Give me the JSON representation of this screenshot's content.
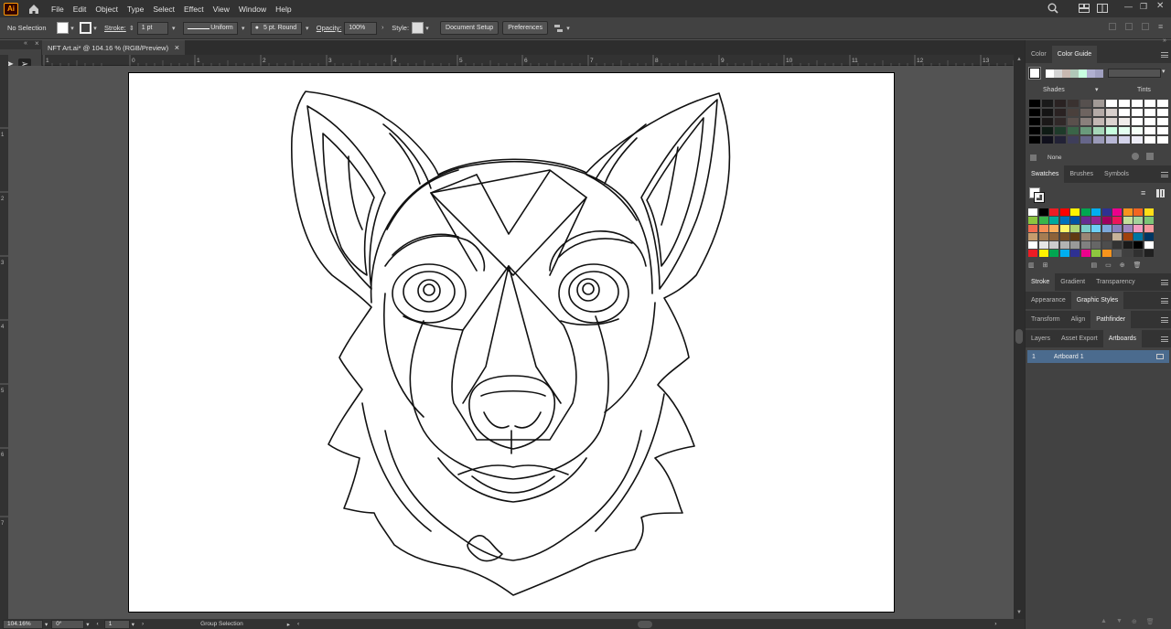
{
  "app": {
    "logo": "Ai",
    "home_icon": "home-icon"
  },
  "menu": [
    "File",
    "Edit",
    "Object",
    "Type",
    "Select",
    "Effect",
    "View",
    "Window",
    "Help"
  ],
  "control_bar": {
    "selection": "No Selection",
    "stroke_label": "Stroke:",
    "stroke_weight": "1 pt",
    "profile": "Uniform",
    "brush": "5 pt. Round",
    "opacity_label": "Opacity:",
    "opacity": "100%",
    "style_label": "Style:",
    "document_setup": "Document Setup",
    "preferences": "Preferences"
  },
  "document": {
    "tab_title": "NFT Art.ai* @ 104.16 % (RGB/Preview)",
    "close": "×"
  },
  "ruler": {
    "h_ticks": [
      "1",
      "0",
      "1",
      "2",
      "3",
      "4",
      "5",
      "6",
      "7",
      "8",
      "9",
      "10",
      "11",
      "12",
      "13"
    ],
    "v_ticks": [
      "1",
      "2",
      "3",
      "4",
      "5",
      "6",
      "7"
    ]
  },
  "status": {
    "zoom": "104.16%",
    "rotate": "0°",
    "artboard": "1",
    "tool": "Group Selection"
  },
  "panels": {
    "color_tabs": [
      "Color",
      "Color Guide"
    ],
    "shades_label": "Shades",
    "tints_label": "Tints",
    "none_label": "None",
    "swatch_tabs": [
      "Swatches",
      "Brushes",
      "Symbols"
    ],
    "stroke_tabs": [
      "Stroke",
      "Gradient",
      "Transparency"
    ],
    "appearance_tabs": [
      "Appearance",
      "Graphic Styles"
    ],
    "transform_tabs": [
      "Transform",
      "Align",
      "Pathfinder"
    ],
    "layers_tabs": [
      "Layers",
      "Asset Export",
      "Artboards"
    ],
    "artboard_row": {
      "index": "1",
      "name": "Artboard 1"
    }
  },
  "colors": {
    "harmony": [
      "#ffffff",
      "#d4d4d4",
      "#c8b8b0",
      "#b0c8b8",
      "#c8ffe0",
      "#b0b0d0",
      "#a0a0c0"
    ],
    "shades": [
      [
        "#000000",
        "#1a1a1a",
        "#2a2222",
        "#3a3230",
        "#56504e",
        "#a29a96",
        "#ffffff",
        "#ffffff",
        "#ffffff",
        "#ffffff",
        "#ffffff"
      ],
      [
        "#000000",
        "#141414",
        "#2a2222",
        "#4a403c",
        "#6e6460",
        "#b4aaa6",
        "#d8d0cc",
        "#ffffff",
        "#ffffff",
        "#ffffff",
        "#ffffff"
      ],
      [
        "#000000",
        "#1a1818",
        "#302828",
        "#5a504c",
        "#8a807c",
        "#c4b8b4",
        "#dcd4d0",
        "#f0ecea",
        "#ffffff",
        "#ffffff",
        "#ffffff"
      ],
      [
        "#000000",
        "#0e1a14",
        "#1e3a2a",
        "#3a6448",
        "#6a9a7c",
        "#a6d6b8",
        "#c8ffe0",
        "#e4fff0",
        "#f4fff8",
        "#ffffff",
        "#ffffff"
      ],
      [
        "#000000",
        "#10101c",
        "#222236",
        "#3e3e5a",
        "#66668a",
        "#9a9ab8",
        "#b8b8d6",
        "#d4d4ea",
        "#ececf6",
        "#ffffff",
        "#ffffff"
      ]
    ],
    "swatches": [
      [
        "#ffffff",
        "#000000",
        "#ed1c24",
        "#ff0000",
        "#fff200",
        "#00a651",
        "#00aeef",
        "#2e3192",
        "#ec008c",
        "#f7941d",
        "#f26522",
        "#ffde17"
      ],
      [
        "#8dc63f",
        "#39b54a",
        "#00a99d",
        "#0072bc",
        "#0054a6",
        "#662d91",
        "#92278f",
        "#9e005d",
        "#ed145b",
        "#c4df9b",
        "#a3d39c",
        "#7cc576"
      ],
      [
        "#f26c4f",
        "#f68e55",
        "#fbaf5c",
        "#fff568",
        "#acd373",
        "#7accc8",
        "#6dcff6",
        "#7da7d9",
        "#8781bd",
        "#a186be",
        "#f49ac1",
        "#f5989d"
      ],
      [
        "#c69c6d",
        "#a67c52",
        "#8c6239",
        "#754c24",
        "#603913",
        "#998675",
        "#736357",
        "#534741",
        "#c7b299",
        "#a0410d",
        "#0076a3",
        "#003663"
      ],
      [
        "#ffffff",
        "#e6e6e6",
        "#cccccc",
        "#b3b3b3",
        "#999999",
        "#808080",
        "#666666",
        "#4d4d4d",
        "#333333",
        "#1a1a1a",
        "#000000",
        "#ffffff"
      ],
      [
        "#ed1c24",
        "#fff200",
        "#00a651",
        "#00aeef",
        "#2e3192",
        "#ec008c",
        "#8dc63f",
        "#f7941d",
        "#606060",
        "#404040",
        "#303030",
        "#202020"
      ]
    ]
  }
}
